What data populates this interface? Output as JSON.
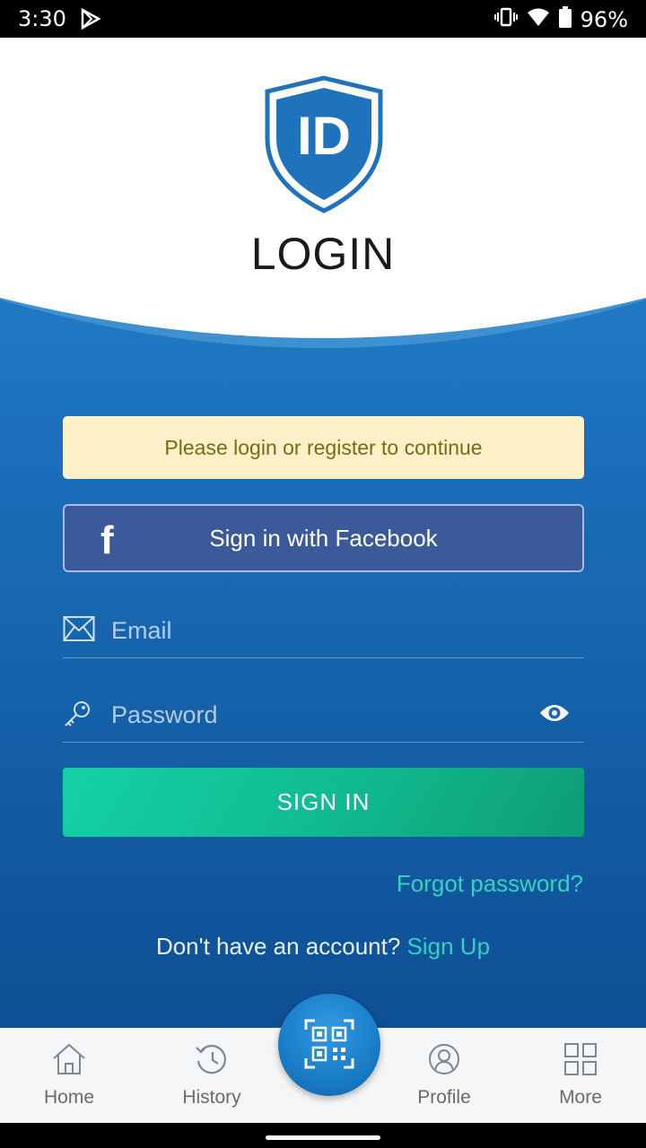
{
  "status_bar": {
    "time": "3:30",
    "battery": "96%"
  },
  "header": {
    "title": "LOGIN",
    "logo_text": "ID"
  },
  "notice": {
    "text": "Please login or register to continue"
  },
  "facebook": {
    "icon_letter": "f",
    "label": "Sign in with Facebook"
  },
  "form": {
    "email": {
      "placeholder": "Email",
      "value": ""
    },
    "password": {
      "placeholder": "Password",
      "value": ""
    },
    "submit_label": "SIGN IN",
    "forgot_label": "Forgot password?"
  },
  "signup": {
    "prompt": "Don't have an account? ",
    "link": "Sign Up"
  },
  "nav": {
    "items": [
      {
        "label": "Home",
        "icon": "home-icon"
      },
      {
        "label": "History",
        "icon": "history-icon"
      },
      {
        "label": "Profile",
        "icon": "profile-icon"
      },
      {
        "label": "More",
        "icon": "grid-icon"
      }
    ],
    "center_icon": "qr-scan-icon"
  },
  "colors": {
    "brand_blue": "#1a6db8",
    "accent_green": "#14d1a6",
    "link_teal": "#35d2c0",
    "facebook_blue": "#3c5a99",
    "notice_bg": "#fbf0c8"
  }
}
